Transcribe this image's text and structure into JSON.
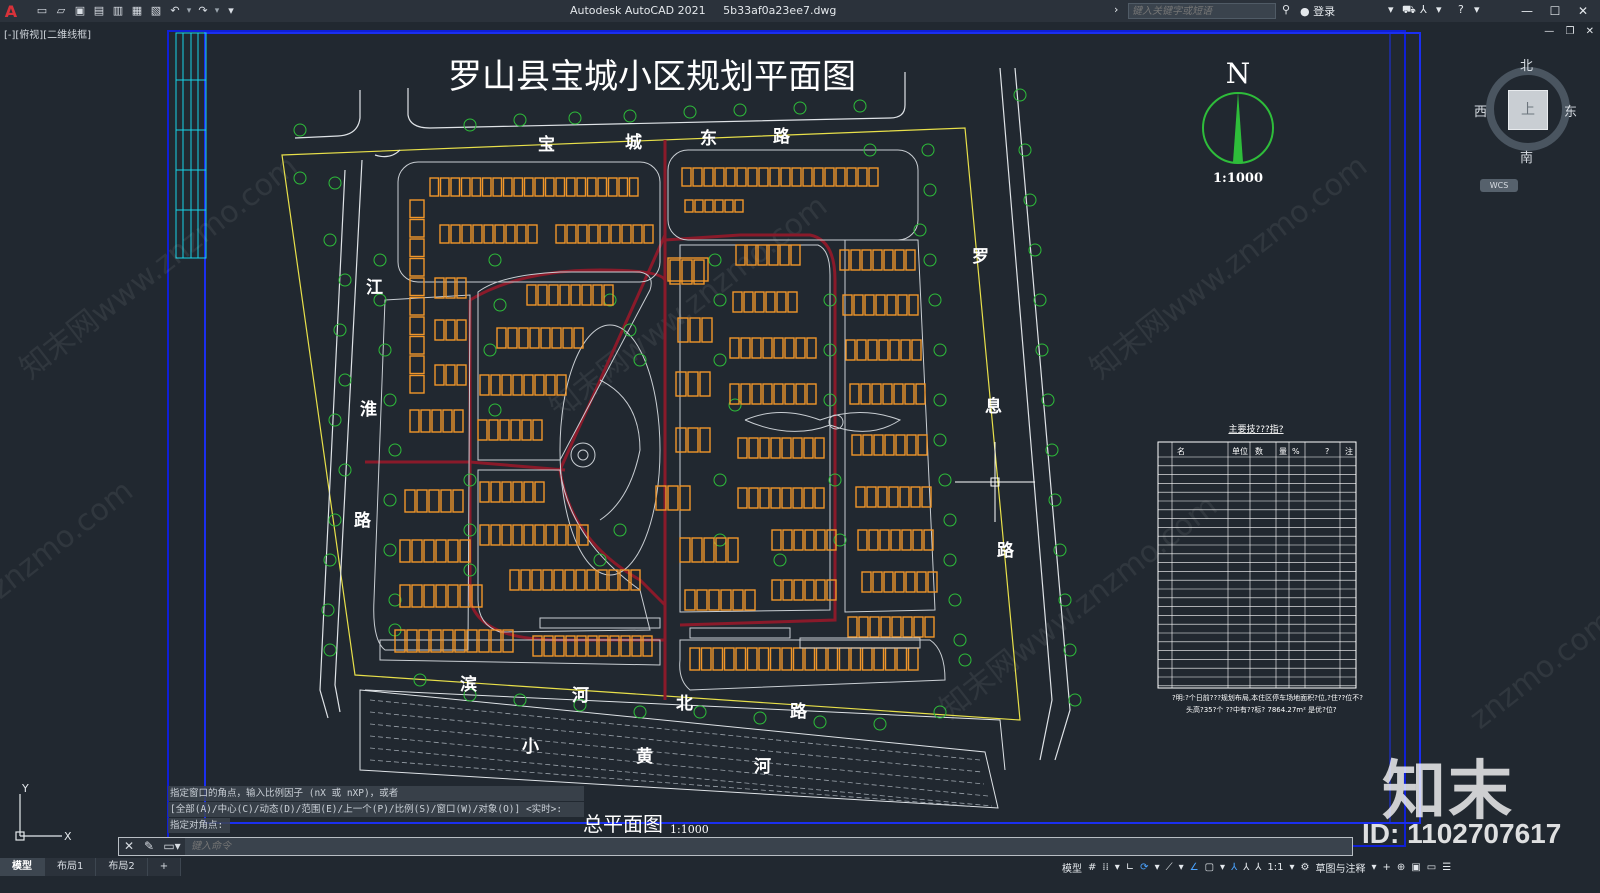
{
  "window": {
    "app_name": "Autodesk AutoCAD 2021",
    "file_name": "5b33af0a23ee7.dwg",
    "search_placeholder": "键入关键字或短语",
    "login_label": "登录"
  },
  "viewport": {
    "label": "[-][俯视][二维线框]"
  },
  "drawing": {
    "title": "罗山县宝城小区规划平面图",
    "footer_title": "总平面图",
    "footer_scale": "1:1000",
    "north_label": "N",
    "north_scale": "1:1000",
    "roads": {
      "top": [
        "宝",
        "城",
        "东",
        "路"
      ],
      "left": [
        "江",
        "淮",
        "路"
      ],
      "right": [
        "罗",
        "息",
        "路"
      ],
      "bottom": [
        "滨",
        "河",
        "北",
        "路"
      ],
      "river": [
        "小",
        "黄",
        "河"
      ]
    },
    "table": {
      "title": "主要技???指?",
      "headers": [
        "名",
        "称",
        "单位",
        "数",
        "量",
        "%",
        "?",
        "注"
      ],
      "note": "?明:?个日前???规划布局,本住区停车场地面积?位,?住??位不?",
      "note2": "头高?35?个 ??中有??标?  7864.27m² 是优?位?"
    },
    "watermarks": [
      "知末网www.znzmo.com",
      "znzmo.com"
    ]
  },
  "viewcube": {
    "north": "北",
    "south": "南",
    "east": "东",
    "west": "西",
    "face": "上",
    "wcs": "WCS"
  },
  "command": {
    "history": [
      "指定窗口的角点，输入比例因子 (nX 或 nXP)，或者",
      "[全部(A)/中心(C)/动态(D)/范围(E)/上一个(P)/比例(S)/窗口(W)/对象(O)] <实时>:",
      "指定对角点:"
    ],
    "input_placeholder": "键入命令"
  },
  "layout_tabs": [
    "模型",
    "布局1",
    "布局2"
  ],
  "status": {
    "model_label": "模型",
    "scale": "1:1",
    "workspace": "草图与注释"
  },
  "overlay": {
    "brand": "知末",
    "id": "ID: 1102707617"
  }
}
